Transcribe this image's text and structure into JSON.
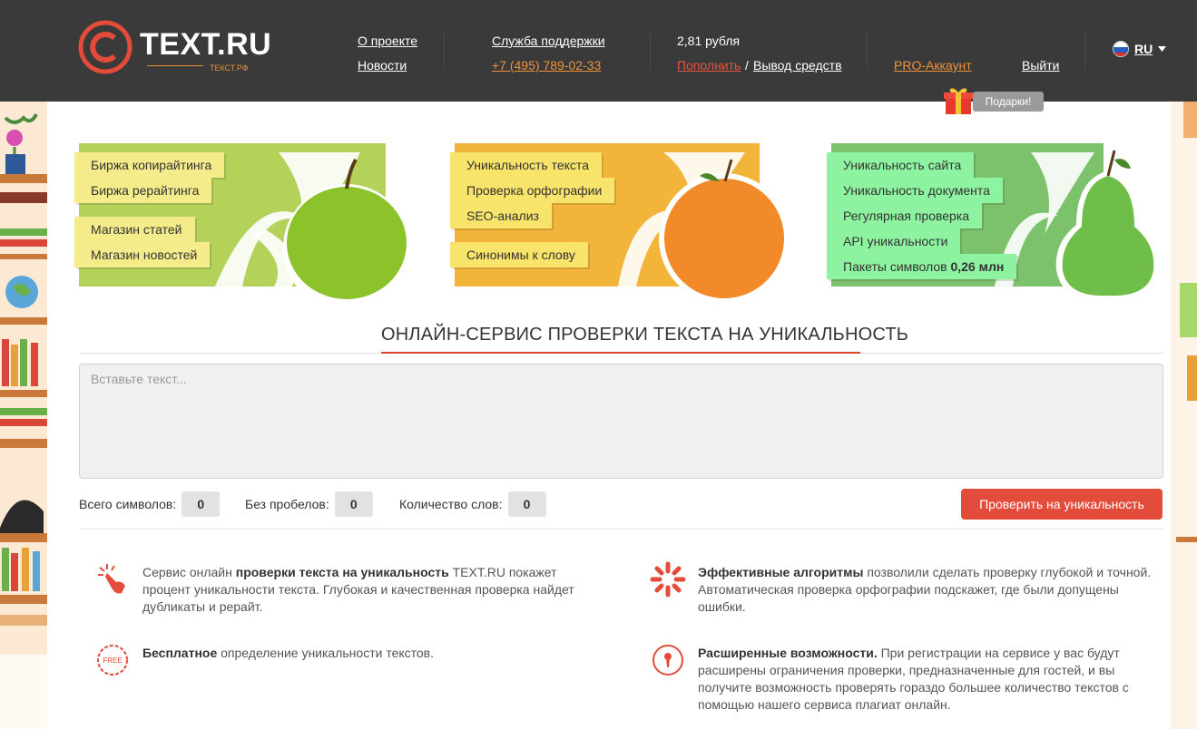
{
  "header": {
    "logo_text": "TEXT.RU",
    "logo_sub": "ТЕКСТ.РФ",
    "nav_about": "О проекте",
    "nav_news": "Новости",
    "support_label": "Служба поддержки",
    "support_phone": "+7 (495) 789-02-33",
    "balance": "2,81 рубля",
    "topup": "Пополнить",
    "balance_sep": "/",
    "withdraw": "Вывод средств",
    "pro_account": "PRO-Аккаунт",
    "logout": "Выйти",
    "lang": "RU",
    "gifts": "Подарки!"
  },
  "banners": {
    "green_left": [
      "Биржа копирайтинга",
      "Биржа рерайтинга",
      "Магазин статей",
      "Магазин новостей"
    ],
    "orange_mid": [
      "Уникальность текста",
      "Проверка орфографии",
      "SEO-анализ",
      "Синонимы к слову"
    ],
    "green_right": [
      "Уникальность сайта",
      "Уникальность документа",
      "Регулярная проверка",
      "API уникальности"
    ],
    "packets_label": "Пакеты символов",
    "packets_value": "0,26 млн"
  },
  "main": {
    "title": "ОНЛАЙН-СЕРВИС ПРОВЕРКИ ТЕКСТА НА УНИКАЛЬНОСТЬ",
    "placeholder": "Вставьте текст...",
    "total_chars_label": "Всего символов:",
    "total_chars": "0",
    "no_spaces_label": "Без пробелов:",
    "no_spaces": "0",
    "words_label": "Количество слов:",
    "words": "0",
    "check_button": "Проверить на уникальность"
  },
  "features": {
    "f1_bold": "проверки текста на уникальность",
    "f1_pre": "Сервис онлайн ",
    "f1_post": " TEXT.RU покажет процент уникальности текста. Глубокая и качественная проверка найдет дубликаты и рерайт.",
    "f2_bold": "Эффективные алгоритмы",
    "f2_post": " позволили сделать проверку глубокой и точной. Автоматическая проверка орфографии подскажет, где были допущены ошибки.",
    "f3_bold": "Бесплатное",
    "f3_post": " определение уникальности текстов.",
    "f4_bold": "Расширенные возможности.",
    "f4_post": " При регистрации на сервисе у вас будут расширены ограничения проверки, предназначенные для гостей, и вы получите возможность проверять гораздо большее количество текстов с помощью нашего сервиса плагиат онлайн.",
    "free_badge": "FREE"
  },
  "colors": {
    "header_bg": "#3a3a3a",
    "accent_red": "#e34b3a",
    "accent_orange": "#f0923a",
    "banner_green": "#b4d25a",
    "banner_orange": "#f2b53a",
    "banner_green2": "#7cc16b"
  }
}
